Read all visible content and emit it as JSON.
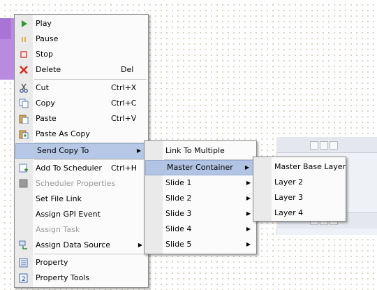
{
  "main_menu": {
    "items": [
      {
        "label": "Play",
        "icon": "play-icon",
        "disabled": false
      },
      {
        "label": "Pause",
        "icon": "pause-icon",
        "disabled": false
      },
      {
        "label": "Stop",
        "icon": "stop-icon",
        "disabled": false
      },
      {
        "label": "Delete",
        "icon": "delete-icon",
        "shortcut": "Del",
        "disabled": false
      },
      {
        "label": "Cut",
        "icon": "cut-icon",
        "shortcut": "Ctrl+X",
        "disabled": false
      },
      {
        "label": "Copy",
        "icon": "copy-icon",
        "shortcut": "Ctrl+C",
        "disabled": false
      },
      {
        "label": "Paste",
        "icon": "paste-icon",
        "shortcut": "Ctrl+V",
        "disabled": false
      },
      {
        "label": "Paste As Copy",
        "icon": "paste-as-copy-icon",
        "disabled": false
      },
      {
        "label": "Send Copy To",
        "submenu": true,
        "highlighted": true
      },
      {
        "label": "Add To Scheduler",
        "icon": "add-to-scheduler-icon",
        "shortcut": "Ctrl+H",
        "disabled": false
      },
      {
        "label": "Scheduler Properties",
        "icon": "scheduler-properties-icon",
        "disabled": true
      },
      {
        "label": "Set File Link",
        "disabled": false
      },
      {
        "label": "Assign GPI Event",
        "disabled": false
      },
      {
        "label": "Assign Task",
        "disabled": true
      },
      {
        "label": "Assign Data Source",
        "icon": "data-source-icon",
        "submenu": true,
        "disabled": false
      },
      {
        "label": "Property",
        "icon": "property-icon",
        "disabled": false
      },
      {
        "label": "Property Tools",
        "icon": "property-tools-icon",
        "disabled": false
      }
    ]
  },
  "send_copy_menu": {
    "items": [
      {
        "label": "Link To Multiple"
      },
      {
        "label": "Master Container",
        "submenu": true,
        "highlighted": true
      },
      {
        "label": "Slide 1",
        "submenu": true
      },
      {
        "label": "Slide 2",
        "submenu": true
      },
      {
        "label": "Slide 3",
        "submenu": true
      },
      {
        "label": "Slide 4",
        "submenu": true
      },
      {
        "label": "Slide 5",
        "submenu": true
      }
    ]
  },
  "master_container_menu": {
    "items": [
      {
        "label": "Master Base Layer"
      },
      {
        "label": "Layer 2"
      },
      {
        "label": "Layer 3"
      },
      {
        "label": "Layer 4"
      }
    ]
  },
  "colors": {
    "highlight": "#b6c8e6",
    "gutter": "#eaeaea",
    "menu_bg": "#fbfbfb"
  }
}
